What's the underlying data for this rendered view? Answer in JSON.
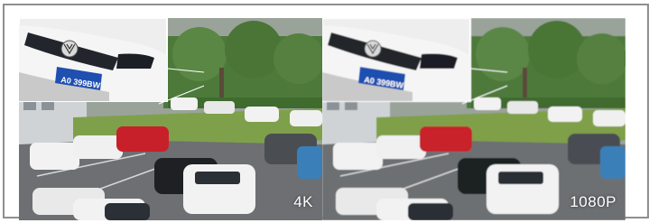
{
  "comparison": {
    "left": {
      "resolution_label": "4K",
      "plate_text": "A0 399BW",
      "blur": 0
    },
    "right": {
      "resolution_label": "1080P",
      "plate_text": "A0 399BW",
      "blur": 0.6
    }
  },
  "colors": {
    "frame_border": "#8f8f8f",
    "asphalt": "#6d6f72",
    "lawn": "#7fa04a",
    "hedge": "#3f6b2f",
    "trees": "#4d7a3a",
    "building": "#cfd3d6",
    "car_red": "#c8202a",
    "car_white": "#f2f2f2",
    "car_black": "#1e2024",
    "car_blue": "#3a7fb8",
    "plate_blue": "#1f4fb0"
  }
}
